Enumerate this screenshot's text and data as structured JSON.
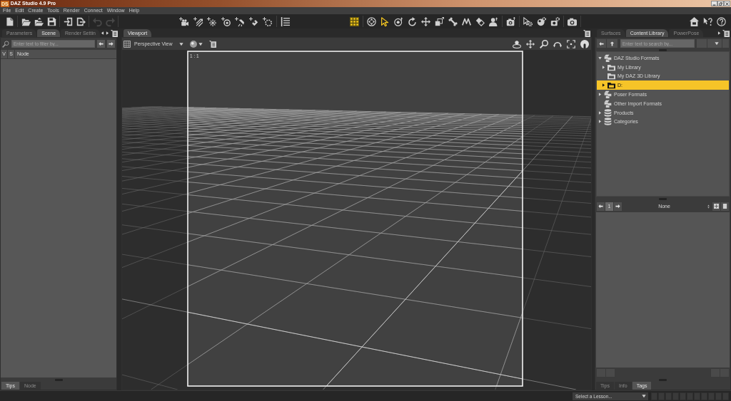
{
  "window": {
    "logo": "DS",
    "title": "DAZ Studio 4.9 Pro"
  },
  "menu_bar": [
    "File",
    "Edit",
    "Create",
    "Tools",
    "Render",
    "Connect",
    "Window",
    "Help"
  ],
  "toolbar": {
    "undo": {
      "disabled": true
    },
    "redo": {
      "disabled": true
    },
    "grid_toggle": {
      "on": true
    },
    "tools": [
      {
        "selected": false
      },
      {
        "selected": true
      },
      {
        "selected": false
      },
      {
        "selected": false
      },
      {
        "selected": false
      },
      {
        "selected": false
      },
      {
        "selected": false
      },
      {
        "selected": false
      },
      {
        "selected": false
      },
      {
        "selected": false
      }
    ]
  },
  "scene_pane": {
    "tabs": [
      {
        "label": "Parameters",
        "selected": false
      },
      {
        "label": "Scene",
        "selected": true
      },
      {
        "label": "Render Settin",
        "selected": false
      }
    ],
    "filter": {
      "placeholder": "Enter text to filter by..."
    },
    "columns": [
      "V",
      "S",
      "Node"
    ],
    "bottom_tabs": [
      {
        "label": "Tips",
        "selected": true
      },
      {
        "label": "Node",
        "selected": false
      }
    ]
  },
  "viewport_pane": {
    "tabs": [
      {
        "label": "Viewport",
        "selected": true
      }
    ],
    "view_menu": "Perspective View",
    "aspect_label": "1 : 1"
  },
  "content_library_pane": {
    "tabs": [
      {
        "label": "Surfaces",
        "selected": false
      },
      {
        "label": "Content Library",
        "selected": true
      },
      {
        "label": "PowerPose",
        "selected": false
      }
    ],
    "search": {
      "placeholder": "Enter text to search by..."
    },
    "tree": [
      {
        "label": "DAZ Studio Formats",
        "kind": "format",
        "expanded": true,
        "selected": false,
        "children": [
          {
            "label": "My Library",
            "kind": "folder",
            "expanded": false,
            "selected": false
          },
          {
            "label": "My DAZ 3D Library",
            "kind": "folder",
            "selected": false
          },
          {
            "label": "D:",
            "kind": "folder",
            "expanded": false,
            "selected": true
          }
        ]
      },
      {
        "label": "Poser Formats",
        "kind": "format",
        "expanded": false,
        "selected": false
      },
      {
        "label": "Other Import Formats",
        "kind": "format",
        "selected": false
      },
      {
        "label": "Products",
        "kind": "database",
        "expanded": false,
        "selected": false
      },
      {
        "label": "Categories",
        "kind": "database",
        "expanded": false,
        "selected": false
      }
    ],
    "page": "1",
    "filter_label": "None",
    "bottom_tabs": [
      {
        "label": "Tips",
        "selected": false
      },
      {
        "label": "Info",
        "selected": false
      },
      {
        "label": "Tags",
        "selected": true
      }
    ]
  },
  "status_bar": {
    "lesson_menu": {
      "value": "Select a Lesson..."
    }
  }
}
